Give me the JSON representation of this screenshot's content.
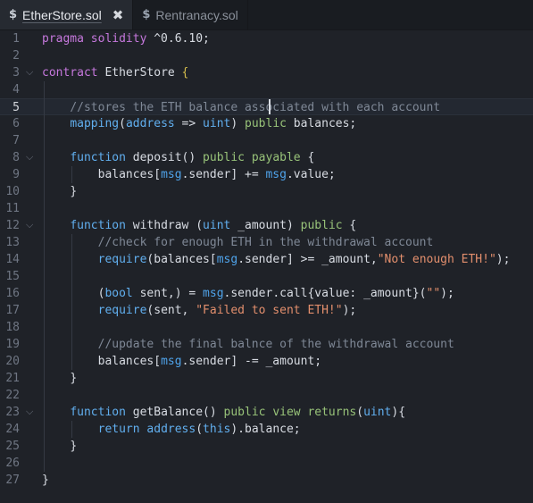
{
  "tabs": [
    {
      "label": "EtherStore.sol",
      "icon": "solidity-icon",
      "active": true,
      "closable": true
    },
    {
      "label": "Rentranacy.sol",
      "icon": "solidity-icon",
      "active": false,
      "closable": false
    }
  ],
  "editor": {
    "current_line": 5,
    "lines": [
      {
        "n": "1"
      },
      {
        "n": "2"
      },
      {
        "n": "3"
      },
      {
        "n": "4"
      },
      {
        "n": "5"
      },
      {
        "n": "6"
      },
      {
        "n": "7"
      },
      {
        "n": "8"
      },
      {
        "n": "9"
      },
      {
        "n": "10"
      },
      {
        "n": "11"
      },
      {
        "n": "12"
      },
      {
        "n": "13"
      },
      {
        "n": "14"
      },
      {
        "n": "15"
      },
      {
        "n": "16"
      },
      {
        "n": "17"
      },
      {
        "n": "18"
      },
      {
        "n": "19"
      },
      {
        "n": "20"
      },
      {
        "n": "21"
      },
      {
        "n": "22"
      },
      {
        "n": "23"
      },
      {
        "n": "24"
      },
      {
        "n": "25"
      },
      {
        "n": "26"
      },
      {
        "n": "27"
      }
    ],
    "code": {
      "l1": [
        "pragma solidity ",
        "^0.6.10",
        ";"
      ],
      "l3": [
        "contract ",
        "EtherStore ",
        "{"
      ],
      "l5": "//stores the ETH balance associated with each account",
      "l6": [
        "mapping",
        "(",
        "address",
        " => ",
        "uint",
        ") ",
        "public",
        " balances;"
      ],
      "l8": [
        "function ",
        "deposit() ",
        "public ",
        "payable",
        " {"
      ],
      "l9": [
        "balances[",
        "msg",
        ".sender] += ",
        "msg",
        ".value;"
      ],
      "l10": "}",
      "l12": [
        "function ",
        "withdraw (",
        "uint",
        " _amount) ",
        "public",
        " {"
      ],
      "l13": "//check for enough ETH in the withdrawal account",
      "l14": [
        "require",
        "(balances[",
        "msg",
        ".sender] >= _amount,",
        "\"Not enough ETH!\"",
        ");"
      ],
      "l16": [
        "(",
        "bool",
        " sent,) = ",
        "msg",
        ".sender.call{value: _amount}(",
        "\"\"",
        ");"
      ],
      "l17": [
        "require",
        "(sent, ",
        "\"Failed to sent ETH!\"",
        ");"
      ],
      "l19": "//update the final balnce of the withdrawal account",
      "l20": [
        "balances[",
        "msg",
        ".sender] -= _amount;"
      ],
      "l21": "}",
      "l23": [
        "function ",
        "getBalance() ",
        "public ",
        "view ",
        "returns",
        "(",
        "uint",
        "){"
      ],
      "l24": [
        "return ",
        "address",
        "(",
        "this",
        ").balance;"
      ],
      "l25": "}",
      "l27": "}"
    }
  }
}
